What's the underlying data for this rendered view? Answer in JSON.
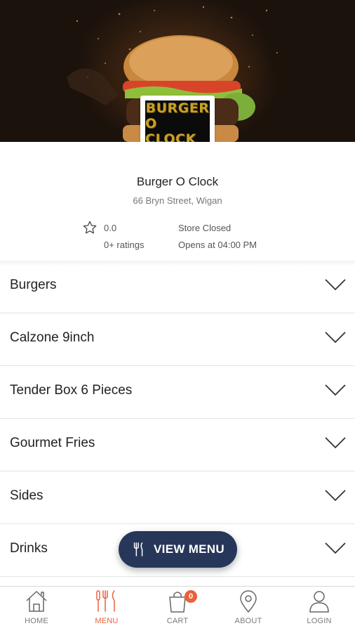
{
  "hero": {
    "image": "burger-photo",
    "logo_lines": [
      "BURGER",
      "O CLOCK"
    ]
  },
  "store": {
    "name": "Burger O Clock",
    "address": "66 Bryn Street, Wigan",
    "rating": "0.0",
    "ratings_count": "0+ ratings",
    "status": "Store Closed",
    "opens": "Opens at 04:00 PM"
  },
  "categories": [
    {
      "label": "Burgers"
    },
    {
      "label": "Calzone 9inch"
    },
    {
      "label": "Tender Box 6 Pieces"
    },
    {
      "label": "Gourmet Fries"
    },
    {
      "label": "Sides"
    },
    {
      "label": "Drinks"
    }
  ],
  "view_menu": {
    "label": "VIEW MENU",
    "icon": "utensils-icon"
  },
  "nav": {
    "items": [
      {
        "label": "HOME",
        "icon": "home-icon"
      },
      {
        "label": "MENU",
        "icon": "utensils-icon",
        "active": true
      },
      {
        "label": "CART",
        "icon": "shopping-bag-icon",
        "badge": "0"
      },
      {
        "label": "ABOUT",
        "icon": "location-pin-icon"
      },
      {
        "label": "LOGIN",
        "icon": "user-icon"
      }
    ]
  },
  "colors": {
    "accent": "#e8623c",
    "button": "#27375a",
    "logo_gold": "#c9a125"
  }
}
